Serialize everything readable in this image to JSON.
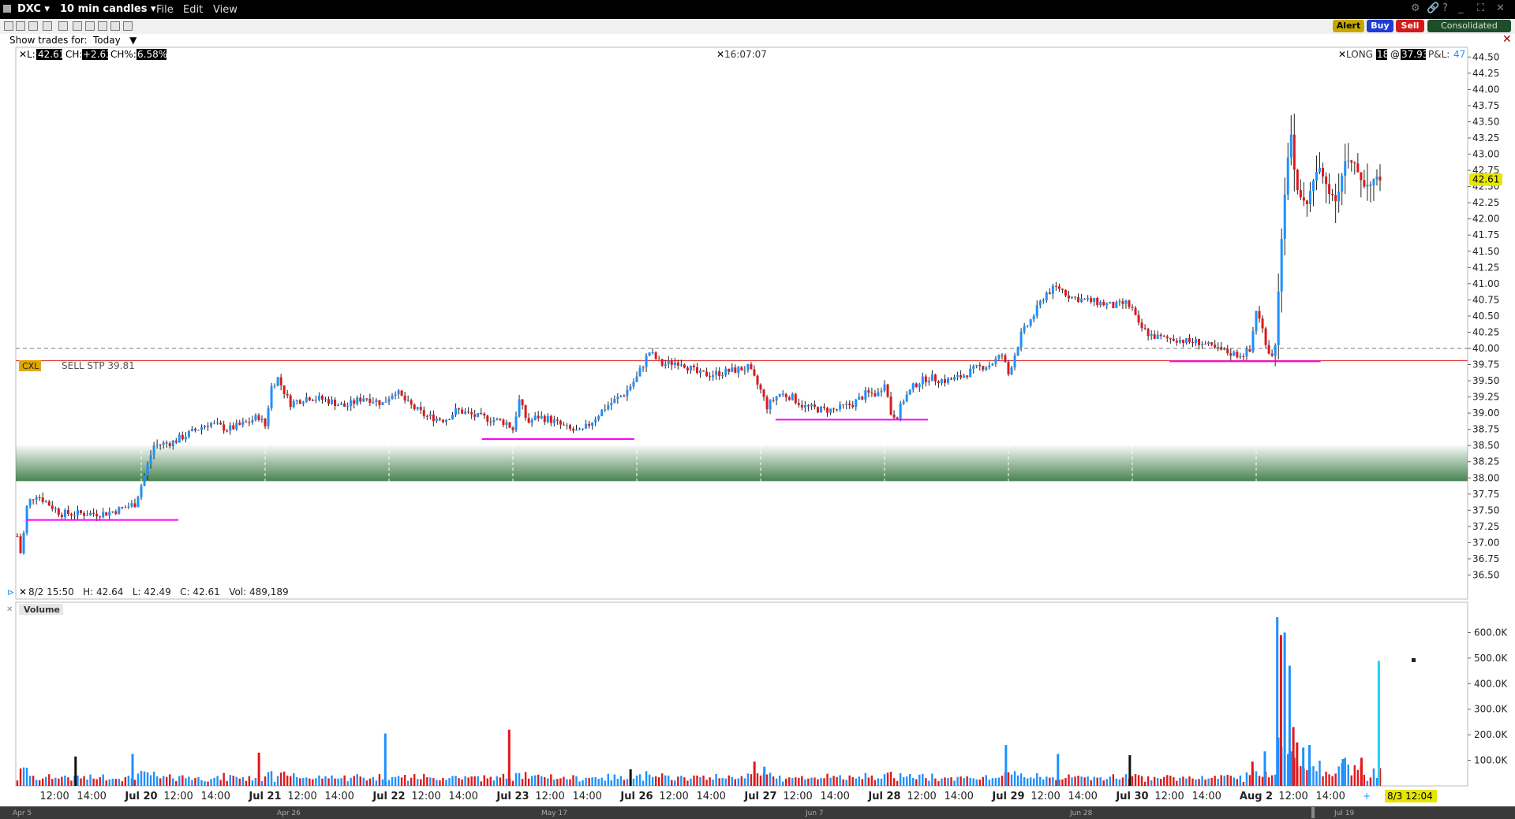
{
  "window": {
    "symbol": "DXC",
    "timeframe": "10 min candles",
    "menus": [
      "File",
      "Edit",
      "View"
    ]
  },
  "toolbar": {
    "show_trades_label": "Show trades for:",
    "show_trades_value": "Today",
    "alert_label": "Alert",
    "buy_label": "Buy",
    "sell_label": "Sell",
    "consolidated_label": "Consolidated"
  },
  "info": {
    "last_label": "L:",
    "last_value": "42.61",
    "change_label": "CH:",
    "change_value": "+2.63",
    "change_pct_label": "CH%:",
    "change_pct_value": "6.58%",
    "time": "16:07:07",
    "position_label": "LONG",
    "position_qty": "18",
    "position_at": "@",
    "position_price": "37.93",
    "pnl_label": "P&L:",
    "pnl_value": "47",
    "bar_info": "8/2 15:50   H: 42.64   L: 42.49   C: 42.61   Vol: 489,189",
    "volume_label": "Volume"
  },
  "order": {
    "cxl_label": "CXL",
    "label": "SELL STP 39.81",
    "price": 39.81
  },
  "colors": {
    "up": "#1e90ff",
    "down": "#e0181b",
    "support_line": "#ff00ff",
    "order_line": "#e33a3a",
    "band": "#3e7d46",
    "price_tag": "#e6e600"
  },
  "bottom": {
    "crosshair_label": "8/3 12:04",
    "overview_labels": [
      "Apr 5",
      "Apr 26",
      "May 17",
      "Jun 7",
      "Jun 28",
      "Jul 19"
    ]
  },
  "chart_data": {
    "type": "candlestick",
    "title": "",
    "y_ticks": [
      "44.50",
      "44.25",
      "44.00",
      "43.75",
      "43.50",
      "43.25",
      "43.00",
      "42.75",
      "42.50",
      "42.25",
      "42.00",
      "41.75",
      "41.50",
      "41.25",
      "41.00",
      "40.75",
      "40.50",
      "40.25",
      "40.00",
      "39.75",
      "39.50",
      "39.25",
      "39.00",
      "38.75",
      "38.50",
      "38.25",
      "38.00",
      "37.75",
      "37.50",
      "37.25",
      "37.00",
      "36.75",
      "36.50"
    ],
    "ylim": [
      36.25,
      44.65
    ],
    "last_price": 42.61,
    "reference_line": 40.0,
    "x_ticks": [
      {
        "label": "12:00",
        "x": 0.3
      },
      {
        "label": "14:00",
        "x": 0.6
      },
      {
        "label": "Jul 20",
        "x": 1.0,
        "bold": true
      },
      {
        "label": "12:00",
        "x": 1.3
      },
      {
        "label": "14:00",
        "x": 1.6
      },
      {
        "label": "Jul 21",
        "x": 2.0,
        "bold": true
      },
      {
        "label": "12:00",
        "x": 2.3
      },
      {
        "label": "14:00",
        "x": 2.6
      },
      {
        "label": "Jul 22",
        "x": 3.0,
        "bold": true
      },
      {
        "label": "12:00",
        "x": 3.3
      },
      {
        "label": "14:00",
        "x": 3.6
      },
      {
        "label": "Jul 23",
        "x": 4.0,
        "bold": true
      },
      {
        "label": "12:00",
        "x": 4.3
      },
      {
        "label": "14:00",
        "x": 4.6
      },
      {
        "label": "Jul 26",
        "x": 5.0,
        "bold": true
      },
      {
        "label": "12:00",
        "x": 5.3
      },
      {
        "label": "14:00",
        "x": 5.6
      },
      {
        "label": "Jul 27",
        "x": 6.0,
        "bold": true
      },
      {
        "label": "12:00",
        "x": 6.3
      },
      {
        "label": "14:00",
        "x": 6.6
      },
      {
        "label": "Jul 28",
        "x": 7.0,
        "bold": true
      },
      {
        "label": "12:00",
        "x": 7.3
      },
      {
        "label": "14:00",
        "x": 7.6
      },
      {
        "label": "Jul 29",
        "x": 8.0,
        "bold": true
      },
      {
        "label": "12:00",
        "x": 8.3
      },
      {
        "label": "14:00",
        "x": 8.6
      },
      {
        "label": "Jul 30",
        "x": 9.0,
        "bold": true
      },
      {
        "label": "12:00",
        "x": 9.3
      },
      {
        "label": "14:00",
        "x": 9.6
      },
      {
        "label": "Aug 2",
        "x": 10.0,
        "bold": true
      },
      {
        "label": "12:00",
        "x": 10.3
      },
      {
        "label": "14:00",
        "x": 10.6
      }
    ],
    "price_path": [
      [
        0.0,
        37.1
      ],
      [
        0.03,
        36.8
      ],
      [
        0.08,
        37.6
      ],
      [
        0.15,
        37.75
      ],
      [
        0.25,
        37.6
      ],
      [
        0.35,
        37.45
      ],
      [
        0.5,
        37.45
      ],
      [
        0.7,
        37.45
      ],
      [
        0.8,
        37.5
      ],
      [
        0.95,
        37.6
      ],
      [
        1.02,
        38.0
      ],
      [
        1.1,
        38.5
      ],
      [
        1.25,
        38.55
      ],
      [
        1.4,
        38.7
      ],
      [
        1.55,
        38.85
      ],
      [
        1.7,
        38.75
      ],
      [
        1.85,
        38.85
      ],
      [
        1.95,
        38.95
      ],
      [
        2.0,
        38.8
      ],
      [
        2.05,
        39.4
      ],
      [
        2.1,
        39.55
      ],
      [
        2.2,
        39.15
      ],
      [
        2.35,
        39.25
      ],
      [
        2.5,
        39.2
      ],
      [
        2.65,
        39.1
      ],
      [
        2.8,
        39.25
      ],
      [
        2.95,
        39.15
      ],
      [
        3.05,
        39.35
      ],
      [
        3.15,
        39.15
      ],
      [
        3.3,
        38.95
      ],
      [
        3.45,
        38.9
      ],
      [
        3.55,
        39.05
      ],
      [
        3.7,
        38.95
      ],
      [
        3.85,
        38.9
      ],
      [
        3.95,
        38.85
      ],
      [
        4.0,
        38.75
      ],
      [
        4.05,
        39.2
      ],
      [
        4.12,
        38.85
      ],
      [
        4.2,
        38.95
      ],
      [
        4.3,
        38.9
      ],
      [
        4.45,
        38.75
      ],
      [
        4.55,
        38.7
      ],
      [
        4.65,
        38.9
      ],
      [
        4.75,
        39.1
      ],
      [
        4.9,
        39.3
      ],
      [
        5.0,
        39.55
      ],
      [
        5.1,
        39.95
      ],
      [
        5.2,
        39.75
      ],
      [
        5.35,
        39.8
      ],
      [
        5.5,
        39.6
      ],
      [
        5.6,
        39.6
      ],
      [
        5.75,
        39.65
      ],
      [
        5.9,
        39.7
      ],
      [
        6.0,
        39.35
      ],
      [
        6.05,
        39.1
      ],
      [
        6.15,
        39.3
      ],
      [
        6.25,
        39.25
      ],
      [
        6.35,
        39.1
      ],
      [
        6.5,
        39.05
      ],
      [
        6.6,
        39.05
      ],
      [
        6.75,
        39.15
      ],
      [
        6.85,
        39.3
      ],
      [
        6.95,
        39.3
      ],
      [
        7.0,
        39.5
      ],
      [
        7.05,
        39.0
      ],
      [
        7.1,
        38.95
      ],
      [
        7.15,
        39.2
      ],
      [
        7.25,
        39.45
      ],
      [
        7.35,
        39.55
      ],
      [
        7.5,
        39.5
      ],
      [
        7.6,
        39.55
      ],
      [
        7.75,
        39.7
      ],
      [
        7.85,
        39.75
      ],
      [
        7.95,
        39.9
      ],
      [
        8.0,
        39.6
      ],
      [
        8.05,
        39.9
      ],
      [
        8.1,
        40.2
      ],
      [
        8.2,
        40.5
      ],
      [
        8.3,
        40.85
      ],
      [
        8.4,
        40.95
      ],
      [
        8.5,
        40.8
      ],
      [
        8.6,
        40.75
      ],
      [
        8.75,
        40.7
      ],
      [
        8.85,
        40.65
      ],
      [
        8.95,
        40.7
      ],
      [
        9.0,
        40.6
      ],
      [
        9.05,
        40.35
      ],
      [
        9.15,
        40.2
      ],
      [
        9.25,
        40.15
      ],
      [
        9.35,
        40.15
      ],
      [
        9.45,
        40.1
      ],
      [
        9.55,
        40.1
      ],
      [
        9.65,
        40.0
      ],
      [
        9.75,
        39.95
      ],
      [
        9.85,
        39.9
      ],
      [
        9.95,
        39.95
      ],
      [
        10.0,
        40.6
      ],
      [
        10.05,
        40.3
      ],
      [
        10.1,
        39.95
      ],
      [
        10.15,
        39.9
      ],
      [
        10.2,
        41.6
      ],
      [
        10.25,
        42.9
      ],
      [
        10.28,
        43.3
      ],
      [
        10.32,
        42.5
      ],
      [
        10.4,
        42.2
      ],
      [
        10.5,
        42.8
      ],
      [
        10.6,
        42.4
      ],
      [
        10.65,
        42.3
      ],
      [
        10.72,
        42.9
      ],
      [
        10.8,
        42.8
      ],
      [
        10.88,
        42.5
      ],
      [
        10.95,
        42.6
      ]
    ],
    "volume_ticks": [
      "600.0K",
      "500.0K",
      "400.0K",
      "300.0K",
      "200.0K",
      "100.0K"
    ],
    "volume_max": 700000,
    "volume_spikes": [
      {
        "x": 0.47,
        "v": 115000,
        "c": "k"
      },
      {
        "x": 0.93,
        "v": 125000,
        "c": "u"
      },
      {
        "x": 1.95,
        "v": 130000,
        "c": "d"
      },
      {
        "x": 2.97,
        "v": 205000,
        "c": "u"
      },
      {
        "x": 3.97,
        "v": 220000,
        "c": "d"
      },
      {
        "x": 4.95,
        "v": 65000,
        "c": "k"
      },
      {
        "x": 5.95,
        "v": 95000,
        "c": "d"
      },
      {
        "x": 6.03,
        "v": 75000,
        "c": "u"
      },
      {
        "x": 7.98,
        "v": 160000,
        "c": "u"
      },
      {
        "x": 8.4,
        "v": 125000,
        "c": "u"
      },
      {
        "x": 8.98,
        "v": 120000,
        "c": "k"
      },
      {
        "x": 9.97,
        "v": 95000,
        "c": "d"
      },
      {
        "x": 10.07,
        "v": 135000,
        "c": "u"
      },
      {
        "x": 10.17,
        "v": 660000,
        "c": "u"
      },
      {
        "x": 10.2,
        "v": 590000,
        "c": "d"
      },
      {
        "x": 10.23,
        "v": 600000,
        "c": "u"
      },
      {
        "x": 10.27,
        "v": 470000,
        "c": "u"
      },
      {
        "x": 10.3,
        "v": 230000,
        "c": "d"
      },
      {
        "x": 10.33,
        "v": 170000,
        "c": "d"
      },
      {
        "x": 10.38,
        "v": 150000,
        "c": "u"
      },
      {
        "x": 10.43,
        "v": 160000,
        "c": "u"
      },
      {
        "x": 10.7,
        "v": 105000,
        "c": "u"
      },
      {
        "x": 10.85,
        "v": 110000,
        "c": "d"
      },
      {
        "x": 10.99,
        "v": 489189,
        "c": "c"
      }
    ],
    "support_lines": [
      {
        "x0": 0.07,
        "x1": 1.3,
        "y": 37.35
      },
      {
        "x0": 3.75,
        "x1": 4.98,
        "y": 38.6
      },
      {
        "x0": 6.12,
        "x1": 7.35,
        "y": 38.9
      },
      {
        "x0": 9.3,
        "x1": 10.52,
        "y": 39.8
      }
    ],
    "band": [
      37.95,
      38.5
    ]
  }
}
